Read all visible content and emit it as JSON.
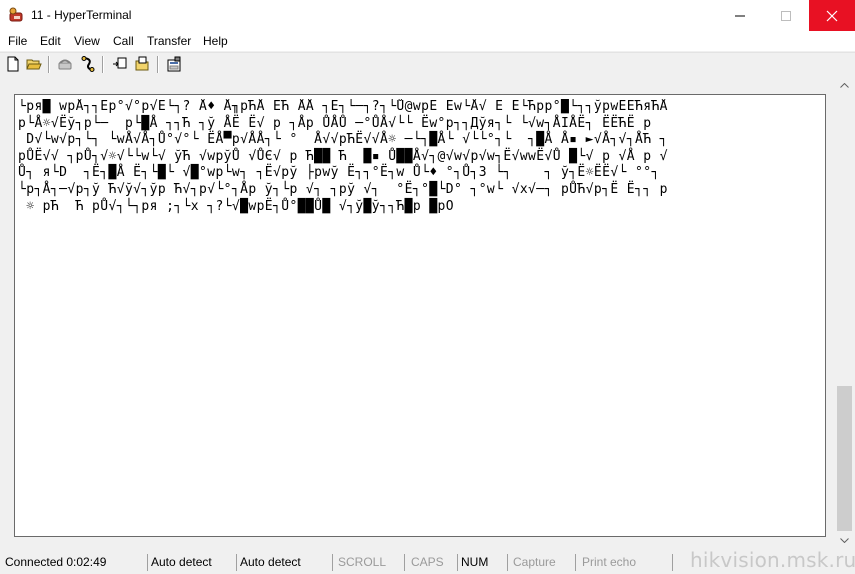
{
  "window": {
    "title": "11 - HyperTerminal"
  },
  "menu": [
    "File",
    "Edit",
    "View",
    "Call",
    "Transfer",
    "Help"
  ],
  "toolbar": {
    "icons": [
      "new-file-icon",
      "open-folder-icon",
      "call-icon",
      "disconnect-icon",
      "send-icon",
      "receive-icon",
      "properties-icon"
    ]
  },
  "terminal": {
    "lines": [
      "└pя█ wpÅ┐┐Ёp°√°p√Ё└┐? Å♦ Å╖pЋÅ ЁЋ ÅÅ ┐Ё┐└─┐?┐└Ů@wpЁ Ёw└Å√ Ё Ё└Ћpp°█└┐┐ўpwЁЁЋяЋÅ",
      "p└Å☼√Ёў┐p└─  p└█Å ┐┐Ћ ┐ў ÅЁ Ё√ p ┐Åp ŮÅŮ ─°ŮÅ√└└ Ёw°p┐┐Дўя┐└ └√w┐ÅIÅЁ┐ ЁЁЋЁ p",
      " D√└w√p┐└┐ └wÅ√Å┐Ů°√°└ ЁÅ▀p√ÅÅ┐└ °  Å√√pЋЁ√√Å☼ ─└┐█Å└ √└└°┐└  ┐█Å Å▪ ►√Å┐√┐ÅЋ ┐",
      "pŮЁ√√ ┐pŮ┐√☼√└└w└√ ўЋ √wpўŮ √ŮЄ√ p Ћ██ Ћ  █▪ Ů██Å√┐@√w√p√w┐Ё√wwЁ√Ů █└√ p √Å p √",
      "Ů┐ я└D  ┐Ё┐█Å Ё┐└█└ √█°wp└w┐ ┐Ё√pў ├pwў Ё┐┐°Ё┐w Ů└♦ °┐Ů┐3 └┐    ┐ ў┐Ё☼ЁЁ√└ °°┐",
      "└p┐Å┐─√p┐ў Ћ√ў√┐ўp Ћ√┐p√└°┐Åp ў┐└p √┐ ┐pў √┐  °Ё┐°█└D° ┐°w└ √x√─┐ pŮЋ√p┐Ё Ё┐┐ p",
      " ☼ pЋ  Ћ pŮ√┐└┐pя ;┐└x ┐?└√█wpЁ┐Ů°██Ů█ √┐ў█ў┐┐Ћ█p █pO"
    ]
  },
  "status": {
    "connected": "Connected 0:02:49",
    "detect1": "Auto detect",
    "detect2": "Auto detect",
    "scroll": "SCROLL",
    "caps": "CAPS",
    "num": "NUM",
    "capture": "Capture",
    "printecho": "Print echo"
  },
  "watermark": "hikvision.msk.ru"
}
